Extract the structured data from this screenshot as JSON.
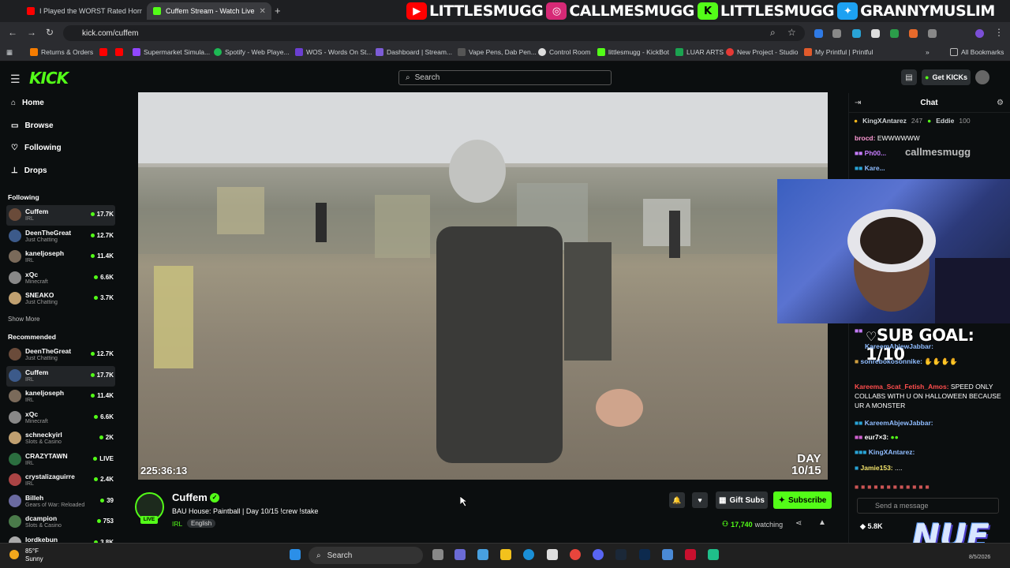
{
  "browser": {
    "tabs": [
      {
        "title": "I Played the WORST Rated Horr",
        "active": false
      },
      {
        "title": "Cuffem Stream - Watch Live",
        "active": true
      }
    ],
    "url": "kick.com/cuffem",
    "bookmarks": [
      "Returns & Orders",
      "Supermarket Simula...",
      "Spotify - Web Playe...",
      "WOS - Words On St...",
      "Dashboard | Stream...",
      "Vape Pens, Dab Pen...",
      "Control Room",
      "littlesmugg - KickBot",
      "LUAR ARTS",
      "New Project - Studio",
      "My Printful | Printful",
      "All Bookmarks"
    ]
  },
  "banner": {
    "items": [
      {
        "text": "LITTLESMUGG",
        "color": "#ff0000",
        "glyph": "▶"
      },
      {
        "text": "CALLMESMUGG",
        "color": "#d62976",
        "glyph": "◎"
      },
      {
        "text": "LITTLESMUGG",
        "color": "#53fc18",
        "glyph": "K"
      },
      {
        "text": "GRANNYMUSLIM",
        "color": "#1da1f2",
        "glyph": "✦"
      }
    ]
  },
  "kick": {
    "search_placeholder": "Search",
    "get_kicks": "Get KICKs",
    "accent": "#53fc18"
  },
  "sidebar": {
    "nav": [
      "Home",
      "Browse",
      "Following",
      "Drops"
    ],
    "following_title": "Following",
    "following": [
      {
        "name": "Cuffem",
        "category": "IRL",
        "viewers": "17.7K",
        "active": true
      },
      {
        "name": "DeenTheGreat",
        "category": "Just Chatting",
        "viewers": "12.7K"
      },
      {
        "name": "kaneljoseph",
        "category": "IRL",
        "viewers": "11.4K"
      },
      {
        "name": "xQc",
        "category": "Minecraft",
        "viewers": "6.6K"
      },
      {
        "name": "SNEAKO",
        "category": "Just Chatting",
        "viewers": "3.7K"
      }
    ],
    "show_more": "Show More",
    "recommended_title": "Recommended",
    "recommended": [
      {
        "name": "DeenTheGreat",
        "category": "Just Chatting",
        "viewers": "12.7K"
      },
      {
        "name": "Cuffem",
        "category": "IRL",
        "viewers": "17.7K",
        "active": true
      },
      {
        "name": "kaneljoseph",
        "category": "IRL",
        "viewers": "11.4K"
      },
      {
        "name": "xQc",
        "category": "Minecraft",
        "viewers": "6.6K"
      },
      {
        "name": "schneckyirl",
        "category": "Slots & Casino",
        "viewers": "2K"
      },
      {
        "name": "CRAZYTAWN",
        "category": "IRL",
        "viewers": "LIVE"
      },
      {
        "name": "crystalizaguirre",
        "category": "IRL",
        "viewers": "2.4K"
      },
      {
        "name": "Billeh",
        "category": "Gears of War: Reloaded",
        "viewers": "39"
      },
      {
        "name": "dcampion",
        "category": "Slots & Casino",
        "viewers": "753"
      },
      {
        "name": "lordkebun",
        "category": "",
        "viewers": "3.8K"
      }
    ]
  },
  "video": {
    "timestamp": "225:36:13",
    "day_line1": "DAY",
    "day_line2": "10/15"
  },
  "stream": {
    "name": "Cuffem",
    "title": "BAU House: Paintball | Day 10/15  !crew !stake",
    "category": "IRL",
    "language": "English",
    "live": "LIVE",
    "gift_subs": "Gift Subs",
    "subscribe": "Subscribe",
    "viewers": "17,740",
    "watching_label": "watching"
  },
  "chat": {
    "title": "Chat",
    "pinned": [
      {
        "user": "KingXAntarez",
        "count": "247"
      },
      {
        "user": "Eddie",
        "count": "100"
      }
    ],
    "messages": [
      {
        "user": "brocd:",
        "text": "EWWWWWW",
        "color": "#ff9ad5"
      },
      {
        "user": "Ph00...",
        "text": "",
        "color": "#c77dff"
      },
      {
        "user": "Kare...",
        "text": "",
        "color": "#8fbcff"
      },
      {
        "user": "KareemAbjewJabbar:",
        "text": "",
        "color": "#8fbcff"
      },
      {
        "user": "sonrebokosonnike:",
        "text": "",
        "color": "#8fbcff"
      },
      {
        "user": "Kareema_Scat_Fetish_Amos:",
        "text": "SPEED ONLY COLLABS WITH U ON HALLOWEEN BECAUSE UR A MONSTER",
        "color": "#ff4d4d"
      },
      {
        "user": "KareemAbjewJabbar:",
        "text": "",
        "color": "#8fbcff"
      },
      {
        "user": "eur7×3:",
        "text": "",
        "color": "#ffffff"
      },
      {
        "user": "KingXAntarez:",
        "text": "",
        "color": "#8fbcff"
      },
      {
        "user": "Jamie153:",
        "text": "....",
        "color": "#f3e36b"
      }
    ],
    "sub_goal": "SUB GOAL: 1/10",
    "cam_handle": "callmesmugg",
    "send_placeholder": "Send a message",
    "kicks": "5.8K",
    "logo": "NUE"
  },
  "taskbar": {
    "temp": "85°F",
    "condition": "Sunny",
    "search": "Search",
    "date": "8/5/2026"
  }
}
